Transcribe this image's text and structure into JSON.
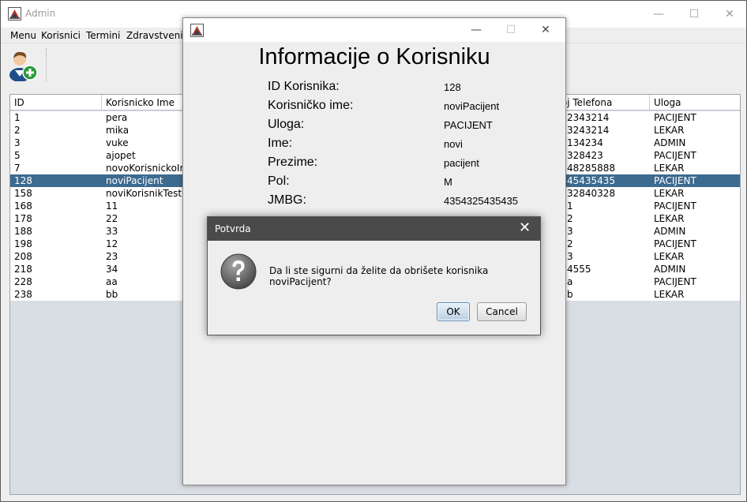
{
  "main_window": {
    "title": "Admin",
    "menu": [
      "Menu",
      "Korisnici",
      "Termini",
      "Zdravstveni K"
    ]
  },
  "table": {
    "headers": [
      "ID",
      "Korisnicko Ime",
      "Broj Telefona",
      "Uloga"
    ],
    "rows": [
      {
        "id": "1",
        "username": "pera",
        "phone": "2343214",
        "role": "PACIJENT"
      },
      {
        "id": "2",
        "username": "mika",
        "phone": "3243214",
        "role": "LEKAR"
      },
      {
        "id": "3",
        "username": "vuke",
        "phone": "134234",
        "role": "ADMIN"
      },
      {
        "id": "5",
        "username": "ajopet",
        "phone": "328423",
        "role": "PACIJENT"
      },
      {
        "id": "7",
        "username": "novoKorisnickoIm",
        "phone": "48285888",
        "role": "LEKAR"
      },
      {
        "id": "128",
        "username": "noviPacijent",
        "phone": "45435435",
        "role": "PACIJENT"
      },
      {
        "id": "158",
        "username": "noviKorisnikTest",
        "phone": "32840328",
        "role": "LEKAR"
      },
      {
        "id": "168",
        "username": "11",
        "phone": "1",
        "role": "PACIJENT"
      },
      {
        "id": "178",
        "username": "22",
        "phone": "2",
        "role": "LEKAR"
      },
      {
        "id": "188",
        "username": "33",
        "phone": "3",
        "role": "ADMIN"
      },
      {
        "id": "198",
        "username": "12",
        "phone": "2",
        "role": "PACIJENT"
      },
      {
        "id": "208",
        "username": "23",
        "phone": "3",
        "role": "LEKAR"
      },
      {
        "id": "218",
        "username": "34",
        "phone": "4555",
        "role": "ADMIN"
      },
      {
        "id": "228",
        "username": "aa",
        "phone": "a",
        "role": "PACIJENT"
      },
      {
        "id": "238",
        "username": "bb",
        "phone": "b",
        "role": "LEKAR"
      }
    ],
    "selected_id": "128"
  },
  "info_dialog": {
    "heading": "Informacije o Korisniku",
    "fields": [
      {
        "label": "ID Korisnika:",
        "value": "128"
      },
      {
        "label": "Korisničko ime:",
        "value": "noviPacijent"
      },
      {
        "label": "Uloga:",
        "value": "PACIJENT"
      },
      {
        "label": "Ime:",
        "value": "novi"
      },
      {
        "label": "Prezime:",
        "value": "pacijent"
      },
      {
        "label": "Pol:",
        "value": "M"
      },
      {
        "label": "JMBG:",
        "value": "4354325435435"
      }
    ]
  },
  "confirm_dialog": {
    "title": "Potvrda",
    "message": "Da li ste sigurni da želite da obrišete korisnika noviPacijent?",
    "ok_label": "OK",
    "cancel_label": "Cancel"
  },
  "colors": {
    "selection": "#3d6a8f",
    "table_background": "#d9dde4",
    "confirm_titlebar": "#4a4a4a"
  },
  "icons": [
    "java-app-icon",
    "add-user-icon",
    "question-icon",
    "minimize-icon",
    "maximize-icon",
    "close-icon"
  ]
}
